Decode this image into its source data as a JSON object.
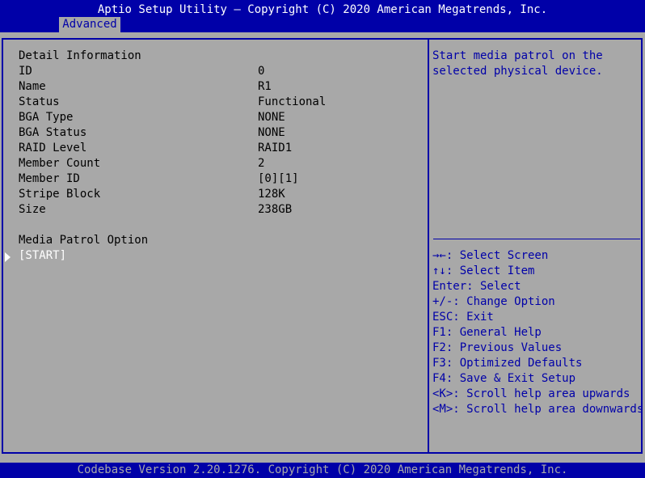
{
  "header": {
    "title": "Aptio Setup Utility – Copyright (C) 2020 American Megatrends, Inc.",
    "active_tab": "Advanced"
  },
  "detail": {
    "heading": "Detail Information",
    "rows": [
      {
        "label": "ID",
        "value": "0"
      },
      {
        "label": "Name",
        "value": "R1"
      },
      {
        "label": "Status",
        "value": "Functional"
      },
      {
        "label": "BGA Type",
        "value": "NONE"
      },
      {
        "label": "BGA Status",
        "value": "NONE"
      },
      {
        "label": "RAID Level",
        "value": "RAID1"
      },
      {
        "label": "Member Count",
        "value": "2"
      },
      {
        "label": "Member ID",
        "value": "[0][1]"
      },
      {
        "label": "Stripe Block",
        "value": "128K"
      },
      {
        "label": "Size",
        "value": "238GB"
      }
    ],
    "patrol_heading": "Media Patrol Option",
    "start_button": "[START]"
  },
  "help": {
    "lines": [
      "Start media patrol on the",
      "selected physical device."
    ]
  },
  "keys": {
    "lines": [
      "→←: Select Screen",
      "↑↓: Select Item",
      "Enter: Select",
      "+/-: Change Option",
      "ESC: Exit",
      "F1: General Help",
      "F2: Previous Values",
      "F3: Optimized Defaults",
      "F4: Save & Exit Setup",
      "<K>: Scroll help area upwards",
      "<M>: Scroll help area downwards"
    ]
  },
  "footer": {
    "text": "Codebase Version 2.20.1276. Copyright (C) 2020 American Megatrends, Inc."
  },
  "colors": {
    "bios_blue": "#0000a8",
    "bios_gray": "#a8a8a8",
    "highlight_white": "#ffffff"
  }
}
